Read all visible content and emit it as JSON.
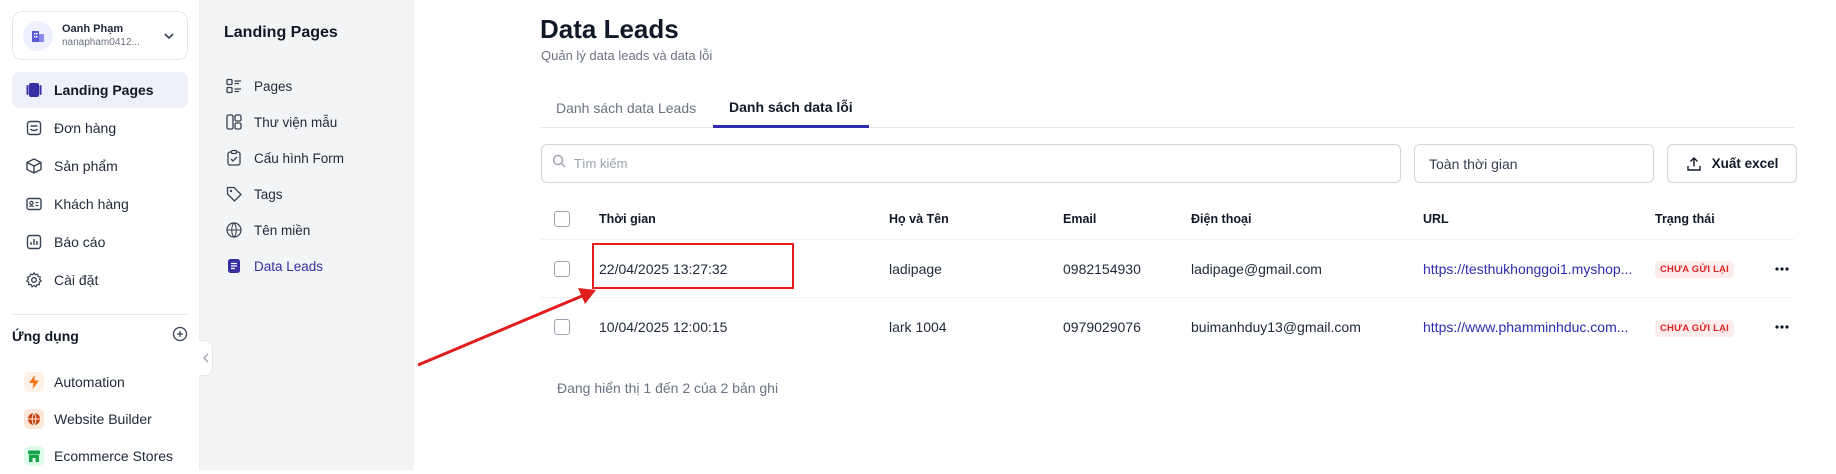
{
  "account": {
    "name": "Oanh Phạm",
    "email": "nanapham0412..."
  },
  "sidebar": {
    "items": [
      {
        "label": "Landing Pages",
        "icon": "landing-pages-icon",
        "active": true
      },
      {
        "label": "Đơn hàng",
        "icon": "orders-icon"
      },
      {
        "label": "Sản phẩm",
        "icon": "box-icon"
      },
      {
        "label": "Khách hàng",
        "icon": "contact-card-icon"
      },
      {
        "label": "Báo cáo",
        "icon": "chart-icon"
      },
      {
        "label": "Cài đặt",
        "icon": "gear-icon"
      }
    ],
    "apps_title": "Ứng dụng",
    "apps": [
      {
        "label": "Automation",
        "icon": "lightning-icon",
        "color": "#f97316"
      },
      {
        "label": "Website Builder",
        "icon": "globe-icon",
        "color": "#c2410c"
      },
      {
        "label": "Ecommerce Stores",
        "icon": "store-icon",
        "color": "#16a34a"
      }
    ]
  },
  "subpanel": {
    "title": "Landing Pages",
    "items": [
      {
        "label": "Pages",
        "icon": "list-icon"
      },
      {
        "label": "Thư viện mẫu",
        "icon": "templates-icon"
      },
      {
        "label": "Cấu hình Form",
        "icon": "clipboard-icon"
      },
      {
        "label": "Tags",
        "icon": "tag-icon"
      },
      {
        "label": "Tên miền",
        "icon": "www-icon"
      },
      {
        "label": "Data Leads",
        "icon": "document-icon",
        "active": true
      }
    ]
  },
  "main": {
    "title": "Data Leads",
    "subtitle": "Quản lý data leads và data lỗi",
    "tabs": [
      {
        "label": "Danh sách data Leads",
        "active": false
      },
      {
        "label": "Danh sách data lỗi",
        "active": true
      }
    ],
    "search_placeholder": "Tìm kiếm",
    "time_filter": "Toàn thời gian",
    "export_label": "Xuất excel",
    "columns": [
      "Thời gian",
      "Họ và Tên",
      "Email",
      "Điện thoại",
      "URL",
      "Trạng thái"
    ],
    "rows": [
      {
        "time": "22/04/2025 13:27:32",
        "name": "ladipage",
        "email": "0982154930",
        "phone": "ladipage@gmail.com",
        "url": "https://testhukhonggoi1.myshop...",
        "status": "CHƯA GỬI LẠI"
      },
      {
        "time": "10/04/2025 12:00:15",
        "name": "lark 1004",
        "email": "0979029076",
        "phone": "buimanhduy13@gmail.com",
        "url": "https://www.phamminhduc.com...",
        "status": "CHƯA GỬI LẠI"
      }
    ],
    "footer": "Đang hiển thị 1 đến 2 của 2 bản ghi"
  },
  "colors": {
    "accent": "#2f2bb0",
    "annotation": "#e11d1d",
    "status_bg": "#fdecec",
    "status_text": "#dc2626"
  }
}
